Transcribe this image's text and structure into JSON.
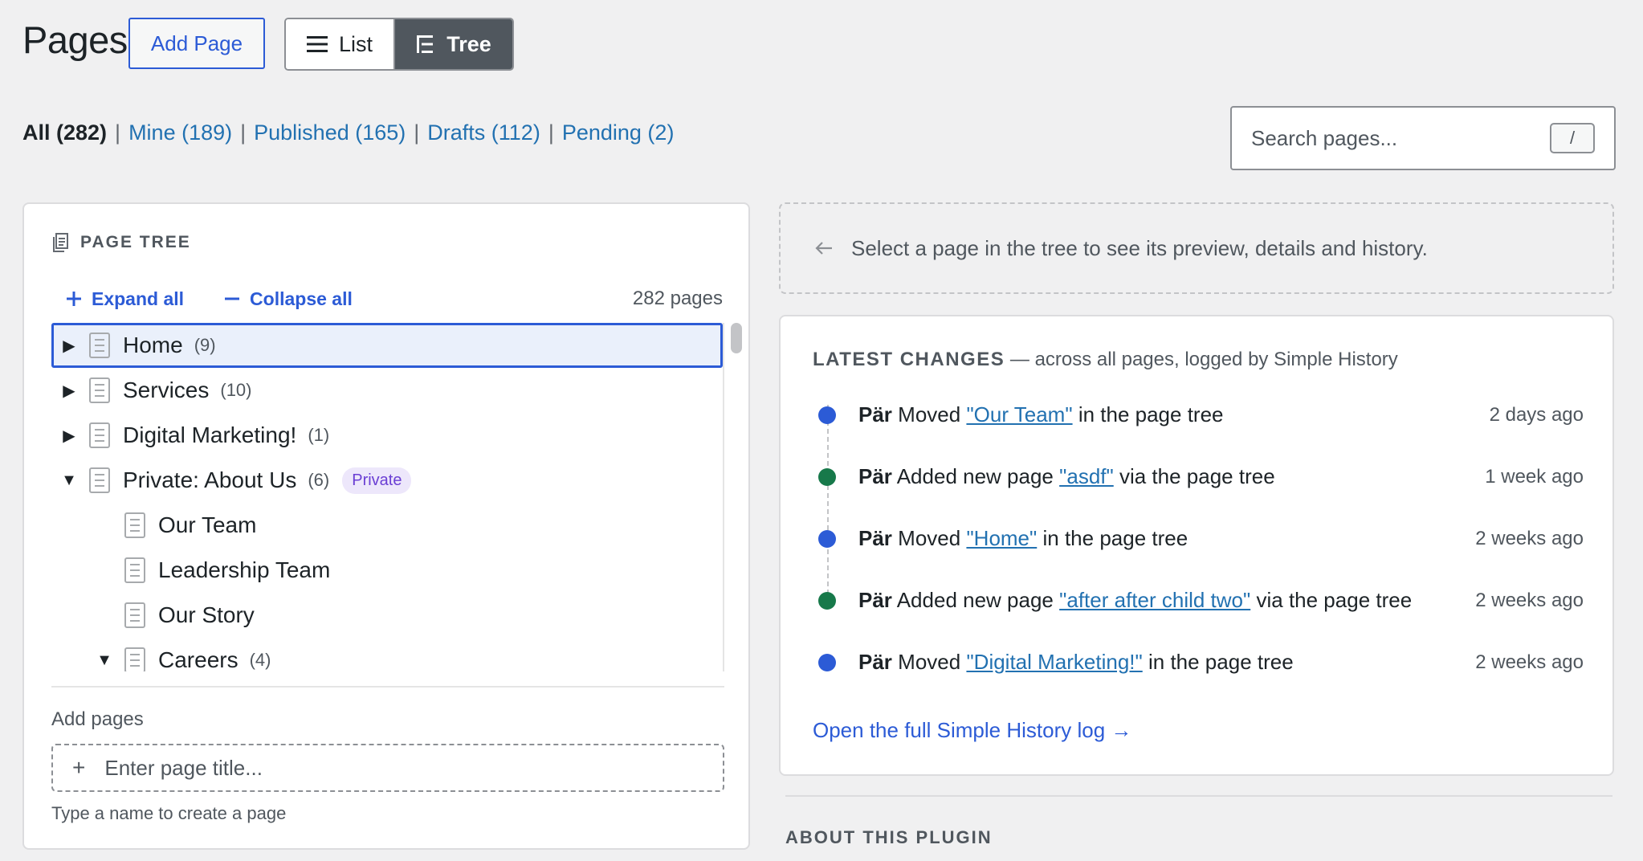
{
  "header": {
    "title": "Pages",
    "add_page_label": "Add Page",
    "view_toggle": {
      "list_label": "List",
      "tree_label": "Tree",
      "active": "Tree"
    }
  },
  "filters": [
    {
      "label": "All (282)",
      "current": true
    },
    {
      "label": "Mine (189)",
      "current": false
    },
    {
      "label": "Published (165)",
      "current": false
    },
    {
      "label": "Drafts (112)",
      "current": false
    },
    {
      "label": "Pending (2)",
      "current": false
    }
  ],
  "search": {
    "placeholder": "Search pages...",
    "shortcut": "/"
  },
  "tree_panel": {
    "heading": "PAGE TREE",
    "expand_all": "Expand all",
    "collapse_all": "Collapse all",
    "page_count": "282 pages",
    "rows": [
      {
        "title": "Home",
        "count": "(9)",
        "caret": "collapsed",
        "badge": "",
        "selected": true
      },
      {
        "title": "Services",
        "count": "(10)",
        "caret": "collapsed",
        "badge": "",
        "selected": false
      },
      {
        "title": "Digital Marketing!",
        "count": "(1)",
        "caret": "collapsed",
        "badge": "",
        "selected": false
      },
      {
        "title": "Private: About Us",
        "count": "(6)",
        "caret": "expanded",
        "badge": "Private",
        "selected": false
      },
      {
        "title": "Our Team",
        "count": "",
        "caret": "none",
        "badge": "",
        "selected": false
      },
      {
        "title": "Leadership Team",
        "count": "",
        "caret": "none",
        "badge": "",
        "selected": false
      },
      {
        "title": "Our Story",
        "count": "",
        "caret": "none",
        "badge": "",
        "selected": false
      },
      {
        "title": "Careers",
        "count": "(4)",
        "caret": "expanded",
        "badge": "",
        "selected": false
      }
    ],
    "add_pages_label": "Add pages",
    "add_input_placeholder": "Enter page title...",
    "add_hint": "Type a name to create a page"
  },
  "select_hint": "Select a page in the tree to see its preview, details and history.",
  "latest_changes": {
    "heading": "LATEST CHANGES",
    "subheading": " — across all pages, logged by Simple History",
    "items": [
      {
        "user": "Pär",
        "action": "Moved",
        "link": "\"Our Team\"",
        "suffix": "in the page tree",
        "time": "2 days ago",
        "color": "#2c5bd6"
      },
      {
        "user": "Pär",
        "action": "Added new page",
        "link": "\"asdf\"",
        "suffix": "via the page tree",
        "time": "1 week ago",
        "color": "#17794a"
      },
      {
        "user": "Pär",
        "action": "Moved",
        "link": "\"Home\"",
        "suffix": "in the page tree",
        "time": "2 weeks ago",
        "color": "#2c5bd6"
      },
      {
        "user": "Pär",
        "action": "Added new page",
        "link": "\"after after child two\"",
        "suffix": "via the page tree",
        "time": "2 weeks ago",
        "color": "#17794a"
      },
      {
        "user": "Pär",
        "action": "Moved",
        "link": "\"Digital Marketing!\"",
        "suffix": "in the page tree",
        "time": "2 weeks ago",
        "color": "#2c5bd6"
      }
    ],
    "full_log_link": "Open the full Simple History log →"
  },
  "about": {
    "heading": "ABOUT THIS PLUGIN"
  }
}
